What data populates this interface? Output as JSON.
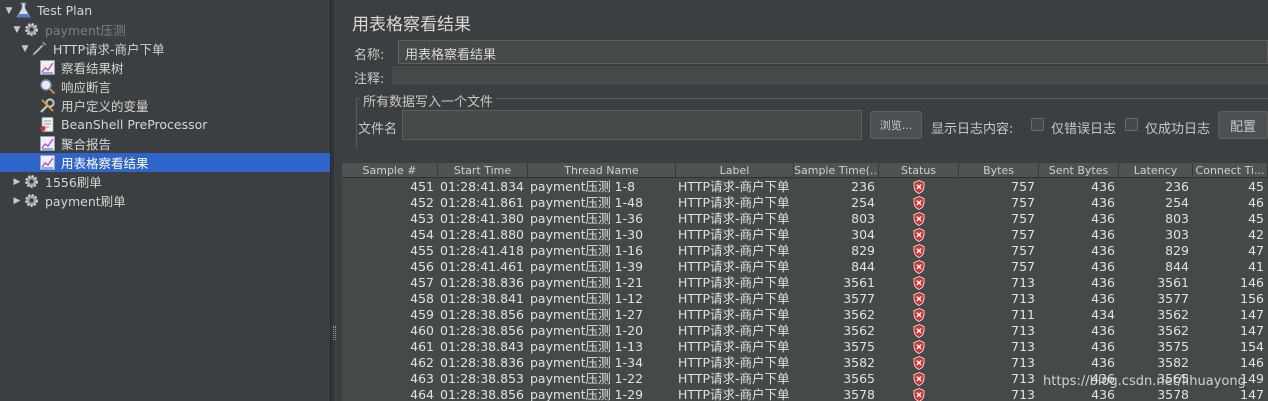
{
  "tree": {
    "items": [
      {
        "label": "Test Plan",
        "arrow": "▼",
        "icon": "flask-icon"
      },
      {
        "label": "payment压测",
        "arrow": "▼",
        "icon": "gear-icon"
      },
      {
        "label": "HTTP请求-商户下单",
        "arrow": "▼",
        "icon": "pipette-icon"
      },
      {
        "label": "察看结果树",
        "arrow": "",
        "icon": "graph-icon"
      },
      {
        "label": "响应断言",
        "arrow": "",
        "icon": "magnifier-icon"
      },
      {
        "label": "用户定义的变量",
        "arrow": "",
        "icon": "wrench-icon"
      },
      {
        "label": "BeanShell PreProcessor",
        "arrow": "",
        "icon": "script-icon"
      },
      {
        "label": "聚合报告",
        "arrow": "",
        "icon": "graph-icon"
      },
      {
        "label": "用表格察看结果",
        "arrow": "",
        "icon": "graph-icon"
      },
      {
        "label": "1556刷单",
        "arrow": "▶",
        "icon": "gear-icon"
      },
      {
        "label": "payment刷单",
        "arrow": "▶",
        "icon": "gear-icon"
      }
    ]
  },
  "panel": {
    "title": "用表格察看结果",
    "name_label": "名称:",
    "name_value": "用表格察看结果",
    "comment_label": "注释:",
    "file_group_title": "所有数据写入一个文件",
    "file_label": "文件名",
    "browse_button": "浏览...",
    "log_content_label": "显示日志内容:",
    "errors_only_label": "仅错误日志",
    "success_only_label": "仅成功日志",
    "configure_button": "配置"
  },
  "table": {
    "columns": [
      "Sample #",
      "Start Time",
      "Thread Name",
      "Label",
      "Sample Time(...",
      "Status",
      "Bytes",
      "Sent Bytes",
      "Latency",
      "Connect Ti..."
    ],
    "rows": [
      [
        "451",
        "01:28:41.834",
        "payment压测 1-8",
        "HTTP请求-商户下单",
        "236",
        "error",
        "757",
        "436",
        "236",
        "45"
      ],
      [
        "452",
        "01:28:41.861",
        "payment压测 1-48",
        "HTTP请求-商户下单",
        "254",
        "error",
        "757",
        "436",
        "254",
        "46"
      ],
      [
        "453",
        "01:28:41.380",
        "payment压测 1-36",
        "HTTP请求-商户下单",
        "803",
        "error",
        "757",
        "436",
        "803",
        "45"
      ],
      [
        "454",
        "01:28:41.880",
        "payment压测 1-30",
        "HTTP请求-商户下单",
        "304",
        "error",
        "757",
        "436",
        "303",
        "42"
      ],
      [
        "455",
        "01:28:41.418",
        "payment压测 1-16",
        "HTTP请求-商户下单",
        "829",
        "error",
        "757",
        "436",
        "829",
        "47"
      ],
      [
        "456",
        "01:28:41.461",
        "payment压测 1-39",
        "HTTP请求-商户下单",
        "844",
        "error",
        "757",
        "436",
        "844",
        "41"
      ],
      [
        "457",
        "01:28:38.836",
        "payment压测 1-21",
        "HTTP请求-商户下单",
        "3561",
        "error",
        "713",
        "436",
        "3561",
        "146"
      ],
      [
        "458",
        "01:28:38.841",
        "payment压测 1-12",
        "HTTP请求-商户下单",
        "3577",
        "error",
        "713",
        "436",
        "3577",
        "156"
      ],
      [
        "459",
        "01:28:38.856",
        "payment压测 1-27",
        "HTTP请求-商户下单",
        "3562",
        "error",
        "711",
        "434",
        "3562",
        "147"
      ],
      [
        "460",
        "01:28:38.856",
        "payment压测 1-20",
        "HTTP请求-商户下单",
        "3562",
        "error",
        "713",
        "436",
        "3562",
        "147"
      ],
      [
        "461",
        "01:28:38.843",
        "payment压测 1-13",
        "HTTP请求-商户下单",
        "3575",
        "error",
        "713",
        "436",
        "3575",
        "154"
      ],
      [
        "462",
        "01:28:38.836",
        "payment压测 1-34",
        "HTTP请求-商户下单",
        "3582",
        "error",
        "713",
        "436",
        "3582",
        "146"
      ],
      [
        "463",
        "01:28:38.853",
        "payment压测 1-22",
        "HTTP请求-商户下单",
        "3565",
        "error",
        "713",
        "436",
        "3565",
        "149"
      ],
      [
        "464",
        "01:28:38.856",
        "payment压测 1-29",
        "HTTP请求-商户下单",
        "3578",
        "error",
        "713",
        "436",
        "3578",
        "147"
      ]
    ]
  },
  "watermark": "https://blog.csdn.net/lihuayong",
  "colors": {
    "selection": "#2f65ca",
    "status_error": "#d0302f"
  }
}
